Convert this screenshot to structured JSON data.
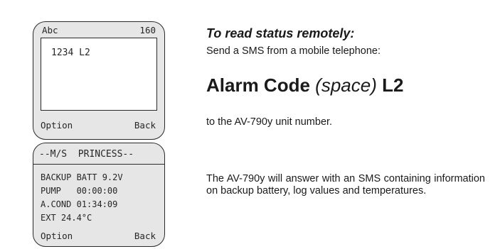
{
  "phone1": {
    "top_left": "Abc",
    "top_right": "160",
    "message": "1234 L2",
    "softkey_left": "Option",
    "softkey_right": "Back"
  },
  "phone2": {
    "title": "--M/S  PRINCESS--",
    "lines": [
      "BACKUP BATT 9.2V",
      "PUMP   00:00:00",
      "A.COND 01:34:09",
      "EXT 24.4°C"
    ],
    "softkey_left": "Option",
    "softkey_right": "Back"
  },
  "instructions": {
    "heading": "To read status remotely:",
    "line1": "Send a SMS from a mobile telephone:",
    "command_part1": "Alarm Code",
    "command_part2": "(space)",
    "command_part3": "L2",
    "line2": "to the AV-790y unit number.",
    "paragraph": "The AV-790y will answer with an SMS containing information on backup battery, log values and temperatures."
  }
}
